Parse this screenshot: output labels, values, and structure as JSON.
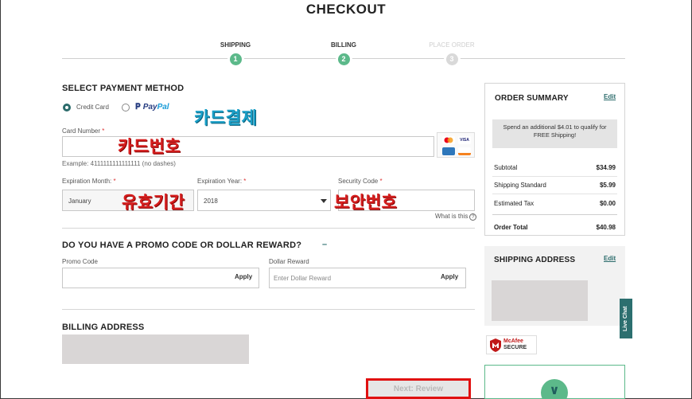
{
  "page": {
    "title": "CHECKOUT"
  },
  "steps": [
    {
      "label": "SHIPPING",
      "num": "1"
    },
    {
      "label": "BILLING",
      "num": "2"
    },
    {
      "label": "PLACE ORDER",
      "num": "3"
    }
  ],
  "payment": {
    "heading": "SELECT PAYMENT METHOD",
    "credit_card_label": "Credit Card",
    "paypal_label_1": "Pay",
    "paypal_label_2": "Pal",
    "card_number_label": "Card Number",
    "card_number_example": "Example: 4111111111111111 (no dashes)",
    "exp_month_label": "Expiration Month:",
    "exp_month_value": "January",
    "exp_year_label": "Expiration Year:",
    "exp_year_value": "2018",
    "security_code_label": "Security Code",
    "what_is_this": "What is this",
    "required_mark": "*",
    "card_logos": [
      "mastercard-icon",
      "visa-icon",
      "amex-icon",
      "discover-icon"
    ],
    "card_logo_text": {
      "visa": "VISA"
    }
  },
  "annotations": {
    "card_payment": "카드결제",
    "card_number": "카드번호",
    "expiry": "유효기간",
    "security": "보안번호"
  },
  "promo": {
    "heading": "DO YOU HAVE A PROMO CODE OR DOLLAR REWARD?",
    "toggle": "–",
    "promo_code_label": "Promo Code",
    "dollar_reward_label": "Dollar Reward",
    "dollar_reward_placeholder": "Enter Dollar Reward",
    "apply_label": "Apply"
  },
  "billing": {
    "heading": "BILLING ADDRESS"
  },
  "next_button": "Next: Review",
  "order_summary": {
    "title": "ORDER SUMMARY",
    "edit": "Edit",
    "free_shipping_msg": "Spend an additional $4.01 to qualify for FREE Shipping!",
    "rows": [
      {
        "label": "Subtotal",
        "amount": "$34.99"
      },
      {
        "label": "Shipping Standard",
        "amount": "$5.99"
      },
      {
        "label": "Estimated Tax",
        "amount": "$0.00"
      }
    ],
    "total_label": "Order Total",
    "total_amount": "$40.98"
  },
  "shipping_address": {
    "title": "SHIPPING ADDRESS",
    "edit": "Edit"
  },
  "mcafee": {
    "line1": "McAfee",
    "line2": "SECURE"
  },
  "live_chat": "Live Chat",
  "colors": {
    "accent": "#5cb98a",
    "teal": "#2c6f6f",
    "annotation_red": "#d61f1f",
    "annotation_blue": "#1aa0c8",
    "highlight_border": "#e01010"
  }
}
